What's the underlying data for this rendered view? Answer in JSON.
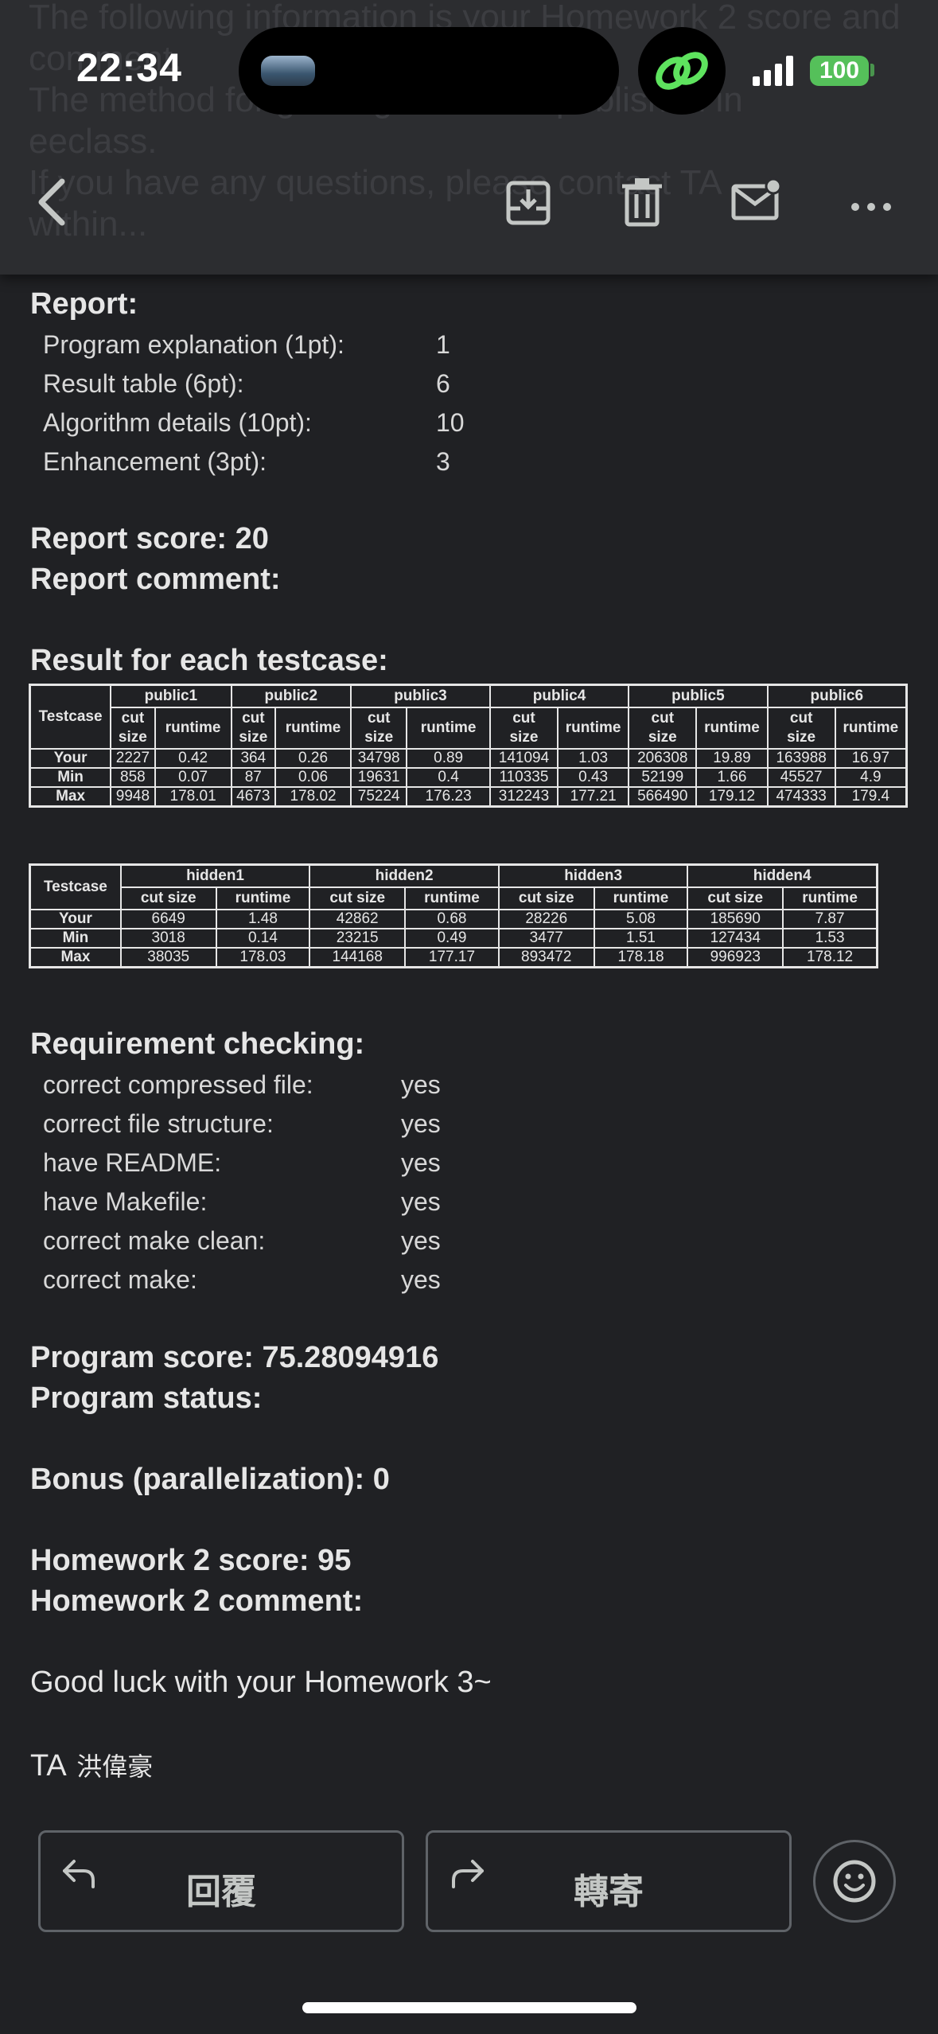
{
  "status_bar": {
    "time": "22:34",
    "battery": "100"
  },
  "ghost_text": [
    "The following information is your Homework 2 score and",
    "comment.",
    "The method for grading has been published in",
    "eeclass.",
    "If you have any questions, please contact TA",
    "within..."
  ],
  "toolbar": {
    "icons": [
      "back-icon",
      "archive-icon",
      "trash-icon",
      "mark-unread-icon",
      "more-icon"
    ]
  },
  "report": {
    "title": "Report:",
    "items": [
      {
        "label": "Program explanation (1pt):",
        "value": "1"
      },
      {
        "label": "Result table (6pt):",
        "value": "6"
      },
      {
        "label": "Algorithm details (10pt):",
        "value": "10"
      },
      {
        "label": "Enhancement (3pt):",
        "value": "3"
      }
    ],
    "score": "Report score: 20",
    "comment": "Report comment:"
  },
  "results": {
    "title": "Result for each testcase:",
    "table1": {
      "corner": "Testcase",
      "cases": [
        "public1",
        "public2",
        "public3",
        "public4",
        "public5",
        "public6"
      ],
      "sub_cut": "cut size",
      "sub_cut_a": "cut",
      "sub_cut_b": "size",
      "sub_run": "runtime",
      "rows": [
        {
          "label": "Your",
          "cells": [
            "2227",
            "0.42",
            "364",
            "0.26",
            "34798",
            "0.89",
            "141094",
            "1.03",
            "206308",
            "19.89",
            "163988",
            "16.97"
          ]
        },
        {
          "label": "Min",
          "cells": [
            "858",
            "0.07",
            "87",
            "0.06",
            "19631",
            "0.4",
            "110335",
            "0.43",
            "52199",
            "1.66",
            "45527",
            "4.9"
          ]
        },
        {
          "label": "Max",
          "cells": [
            "9948",
            "178.01",
            "4673",
            "178.02",
            "75224",
            "176.23",
            "312243",
            "177.21",
            "566490",
            "179.12",
            "474333",
            "179.4"
          ]
        }
      ]
    },
    "table2": {
      "corner": "Testcase",
      "cases": [
        "hidden1",
        "hidden2",
        "hidden3",
        "hidden4"
      ],
      "sub_cut": "cut size",
      "sub_run": "runtime",
      "rows": [
        {
          "label": "Your",
          "cells": [
            "6649",
            "1.48",
            "42862",
            "0.68",
            "28226",
            "5.08",
            "185690",
            "7.87"
          ]
        },
        {
          "label": "Min",
          "cells": [
            "3018",
            "0.14",
            "23215",
            "0.49",
            "3477",
            "1.51",
            "127434",
            "1.53"
          ]
        },
        {
          "label": "Max",
          "cells": [
            "38035",
            "178.03",
            "144168",
            "177.17",
            "893472",
            "178.18",
            "996923",
            "178.12"
          ]
        }
      ]
    }
  },
  "requirements": {
    "title": "Requirement checking:",
    "items": [
      {
        "label": "correct compressed file:",
        "value": "yes"
      },
      {
        "label": "correct file structure:",
        "value": "yes"
      },
      {
        "label": "have README:",
        "value": "yes"
      },
      {
        "label": "have Makefile:",
        "value": "yes"
      },
      {
        "label": "correct make clean:",
        "value": "yes"
      },
      {
        "label": "correct make:",
        "value": "yes"
      }
    ]
  },
  "program": {
    "score": "Program score: 75.28094916",
    "status": "Program status:"
  },
  "bonus": "Bonus (parallelization): 0",
  "homework": {
    "score": "Homework 2 score: 95",
    "comment": "Homework 2 comment:"
  },
  "closing": "Good luck with your Homework 3~",
  "signature": {
    "ta": "TA",
    "name": "洪偉豪"
  },
  "actions": {
    "reply": "回覆",
    "forward": "轉寄"
  }
}
